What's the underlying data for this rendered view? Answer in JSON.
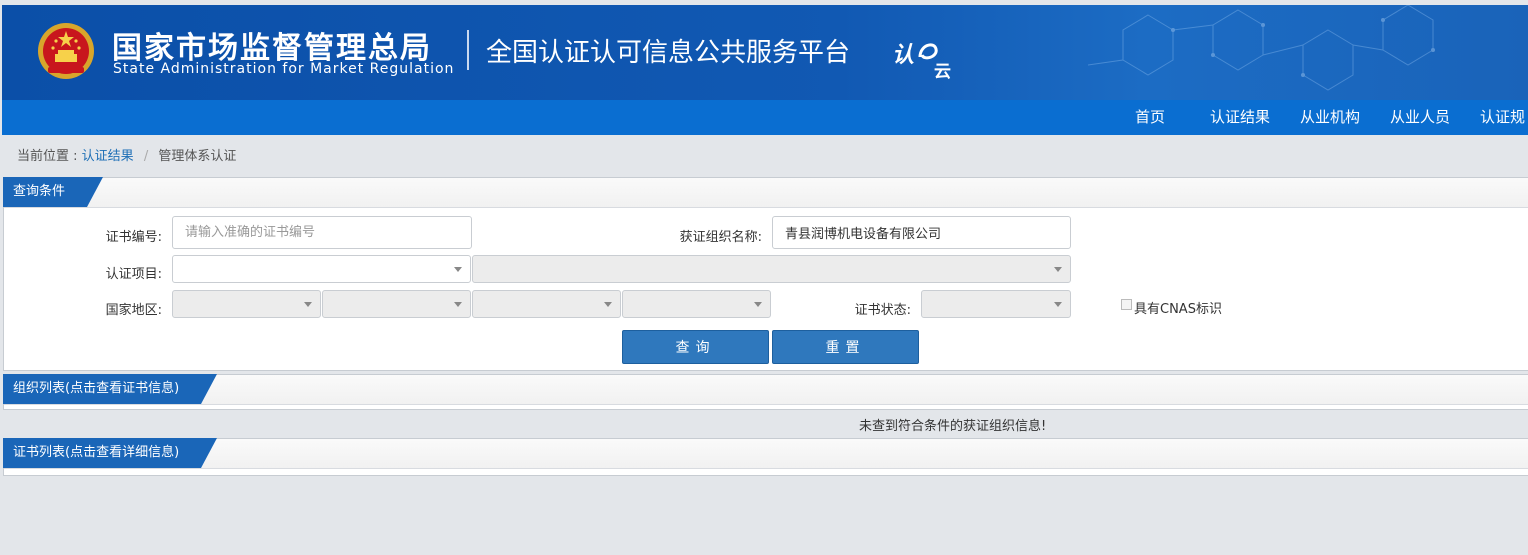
{
  "header": {
    "agency_cn": "国家市场监督管理总局",
    "agency_en": "State Administration  for  Market Regulation",
    "platform_title": "全国认证认可信息公共服务平台",
    "logo_text": "认e云",
    "brand_color": "#0b4fa8",
    "nav_color": "#0a6ed1"
  },
  "nav": {
    "items": [
      {
        "label": "首页"
      },
      {
        "label": "认证结果"
      },
      {
        "label": "从业机构"
      },
      {
        "label": "从业人员"
      },
      {
        "label": "认证规"
      }
    ]
  },
  "breadcrumb": {
    "prefix": "当前位置 :",
    "link": "认证结果",
    "separator": "/",
    "current": "管理体系认证"
  },
  "query": {
    "title": "查询条件",
    "cert_no_label": "证书编号:",
    "cert_no_placeholder": "请输入准确的证书编号",
    "cert_no_value": "",
    "org_name_label": "获证组织名称:",
    "org_name_value": "青县润博机电设备有限公司",
    "project_label": "认证项目:",
    "region_label": "国家地区:",
    "status_label": "证书状态:",
    "cnas_label": "具有CNAS标识",
    "cnas_checked": false,
    "search_button": "查询",
    "reset_button": "重置",
    "button_color": "#2f78bd"
  },
  "org_list": {
    "title": "组织列表(点击查看证书信息)",
    "empty_message": "未查到符合条件的获证组织信息!"
  },
  "cert_list": {
    "title": "证书列表(点击查看详细信息)"
  },
  "icons": {
    "emblem": "national-emblem-icon",
    "dropdown": "chevron-down-icon"
  }
}
